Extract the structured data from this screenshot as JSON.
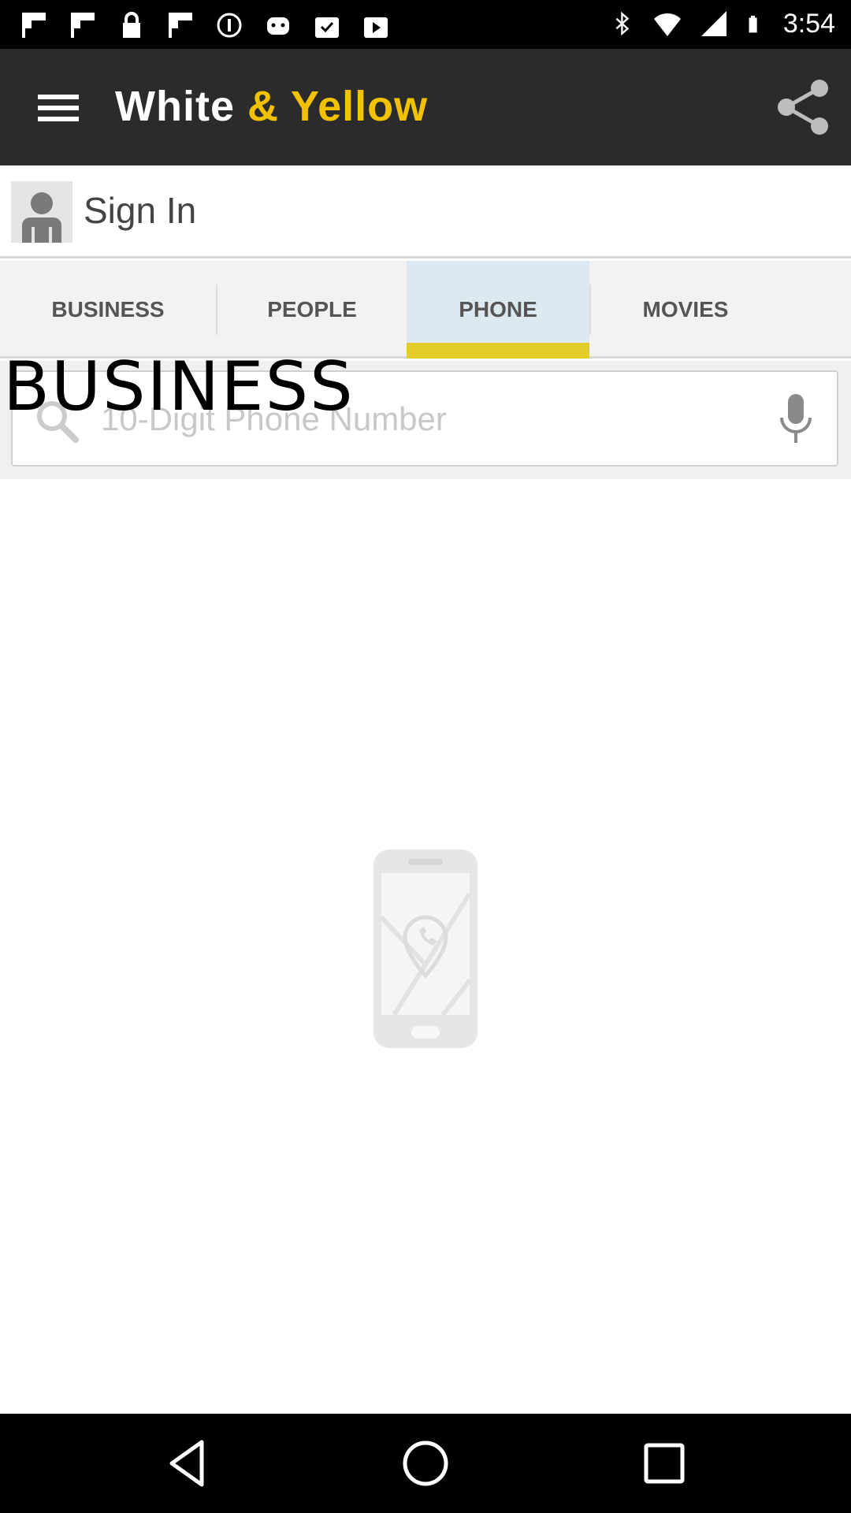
{
  "status_bar": {
    "time": "3:54",
    "left_icons": [
      "flipboard-icon",
      "flipboard-icon",
      "lock-icon",
      "flipboard-icon",
      "info-icon",
      "android-icon",
      "shopping-bag-check-icon",
      "shopping-bag-play-icon"
    ],
    "right_icons": [
      "bluetooth-icon",
      "wifi-icon",
      "signal-icon",
      "battery-icon"
    ]
  },
  "app_bar": {
    "title_part1": "White",
    "title_part2": "& Yellow",
    "brand_yellow": "#f2c200",
    "background": "#2b2b2b"
  },
  "account": {
    "sign_in_label": "Sign In"
  },
  "tabs": [
    {
      "label": "BUSINESS",
      "active": false
    },
    {
      "label": "PEOPLE",
      "active": false
    },
    {
      "label": "PHONE",
      "active": true
    },
    {
      "label": "MOVIES",
      "active": false
    }
  ],
  "overlay": {
    "text": "BUSINESS"
  },
  "search": {
    "placeholder": "10-Digit Phone Number",
    "value": ""
  },
  "navigation": {
    "buttons": [
      "back-icon",
      "home-icon",
      "recents-icon"
    ]
  }
}
